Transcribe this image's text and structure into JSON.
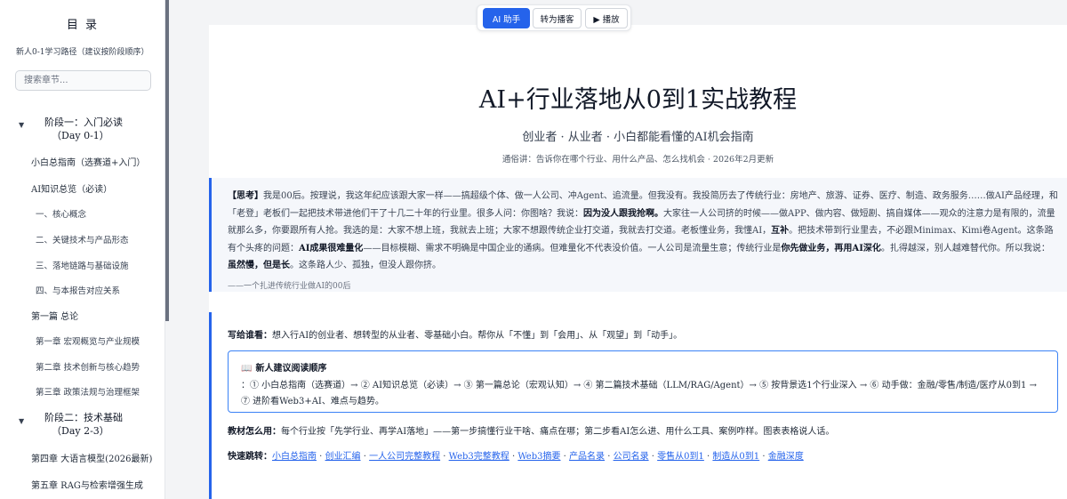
{
  "sidebar": {
    "title": "目 录",
    "subtitle": "新人0-1学习路径（建议按阶段顺序）",
    "search_placeholder": "搜索章节...",
    "stage1": {
      "caret": "▼",
      "line1": "阶段一：入门必读",
      "line2": "（Day 0-1）"
    },
    "items1": [
      "小白总指南（选赛道+入门）",
      "AI知识总览（必读）",
      "一、核心概念",
      "二、关键技术与产品形态",
      "三、落地链路与基础设施",
      "四、与本报告对应关系",
      "第一篇 总论",
      "第一章 宏观概览与产业规模",
      "第二章 技术创新与核心趋势",
      "第三章 政策法规与治理框架"
    ],
    "stage2": {
      "caret": "▼",
      "line1": "阶段二：技术基础",
      "line2": "（Day 2-3）"
    },
    "items2": [
      "第四章 大语言模型(2026最新)",
      "第五章 RAG与检索增强生成"
    ]
  },
  "toolbar": {
    "ai_label": "AI 助手",
    "podcast_label": "转为播客",
    "play_label": "▶ 播放"
  },
  "doc": {
    "title": "AI+行业落地从0到1实战教程",
    "subtitle": "创业者 · 从业者 · 小白都能看懂的AI机会指南",
    "meta": "通俗讲：告诉你在哪个行业、用什么产品、怎么找机会 · 2026年2月更新"
  },
  "think": {
    "tag": "【思考】",
    "t1": "我是00后。按理说，我这年纪应该跟大家一样——搞超级个体、做一人公司、冲Agent、追流量。但我没有。我投简历去了传统行业：房地产、旅游、证券、医疗、制造、政务服务……做AI产品经理，和「老登」老板们一起把技术带进他们干了十几二十年的行业里。很多人问：你图啥？我说：",
    "b1": "因为没人跟我抢啊。",
    "t2": "大家往一人公司挤的时候——做APP、做内容、做短剧、搞自媒体——观众的注意力是有限的，流量就那么多，你要跟所有人抢。我选的是：大家不想上班，我就去上班；大家不想跟传统企业打交道，我就去打交道。老板懂业务，我懂AI，",
    "b2": "互补",
    "t3": "。把技术带到行业里去，不必跟Minimax、Kimi卷Agent。这条路有个头疼的问题：",
    "b3": "AI成果很难量化",
    "t4": "——目标模糊、需求不明确是中国企业的通病。但难量化不代表没价值。一人公司是流量生意；传统行业是",
    "b4": "你先做业务，再用AI深化",
    "t5": "。扎得越深，别人越难替代你。所以我说：",
    "b5": "虽然慢，但是长",
    "t6": "。这条路人少、孤独，但没人跟你挤。",
    "sign": "——一个扎进传统行业做AI的00后"
  },
  "info": {
    "audience_label": "写给谁看：",
    "audience_text": "想入行AI的创业者、想转型的从业者、零基础小白。帮你从「不懂」到「会用」、从「观望」到「动手」。",
    "order_icon": "📖",
    "order_title": "新人建议阅读顺序",
    "order_text": "：① 小白总指南（选赛道）→ ② AI知识总览（必读）→ ③ 第一篇总论（宏观认知）→ ④ 第二篇技术基础（LLM/RAG/Agent）→ ⑤ 按背景选1个行业深入 → ⑥ 动手做：金融/零售/制造/医疗从0到1 → ⑦ 进阶看Web3+AI、难点与趋势。",
    "usage_label": "教材怎么用：",
    "usage_text": "每个行业按「先学行业、再学AI落地」——第一步搞懂行业干啥、痛点在哪；第二步看AI怎么进、用什么工具、案例咋样。图表表格说人话。",
    "jump_label": "快速跳转：",
    "links": [
      "小白总指南",
      "创业汇编",
      "一人公司完整教程",
      "Web3完整教程",
      "Web3摘要",
      "产品名录",
      "公司名录",
      "零售从0到1",
      "制造从0到1",
      "金融深度"
    ]
  }
}
